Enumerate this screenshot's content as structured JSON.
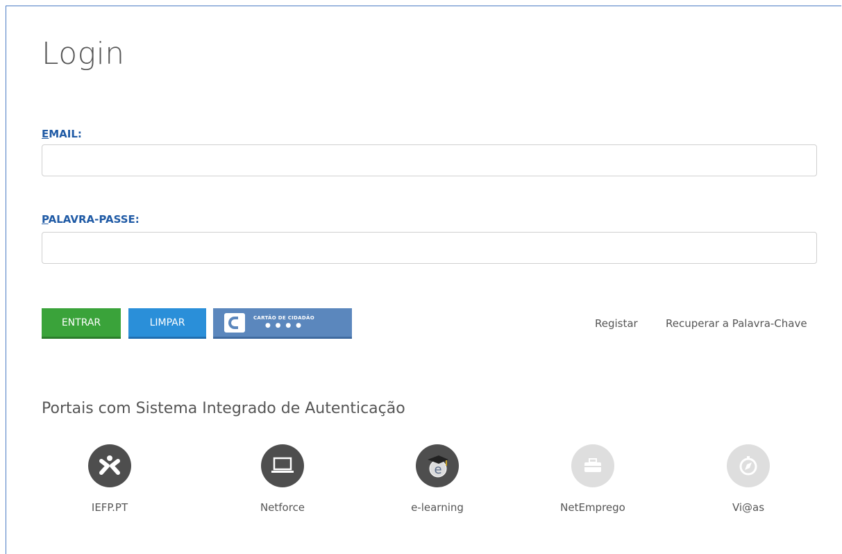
{
  "page": {
    "title": "Login"
  },
  "form": {
    "email_label_first": "E",
    "email_label_rest": "MAIL:",
    "email_value": "",
    "password_label_first": "P",
    "password_label_rest": "ALAVRA-PASSE:",
    "password_value": ""
  },
  "actions": {
    "entrar": "ENTRAR",
    "limpar": "LIMPAR",
    "cartao": "CARTÃO DE CIDADÃO",
    "cartao_dots": "● ● ● ●",
    "registar": "Registar",
    "recuperar": "Recuperar a Palavra-Chave"
  },
  "portals": {
    "heading": "Portais com Sistema Integrado de Autenticação",
    "items": [
      {
        "name": "IEFP.PT",
        "icon": "iefp-logo-icon",
        "style": "dark"
      },
      {
        "name": "Netforce",
        "icon": "laptop-icon",
        "style": "dark"
      },
      {
        "name": "e-learning",
        "icon": "graduation-e-icon",
        "style": "dark"
      },
      {
        "name": "NetEmprego",
        "icon": "briefcase-icon",
        "style": "light"
      },
      {
        "name": "Vi@as",
        "icon": "compass-icon",
        "style": "light"
      }
    ]
  },
  "colors": {
    "label_blue": "#1f5aa5",
    "entrar_green": "#3aa33a",
    "limpar_blue": "#2a8fd9",
    "cartao_blue": "#5b87bd"
  }
}
